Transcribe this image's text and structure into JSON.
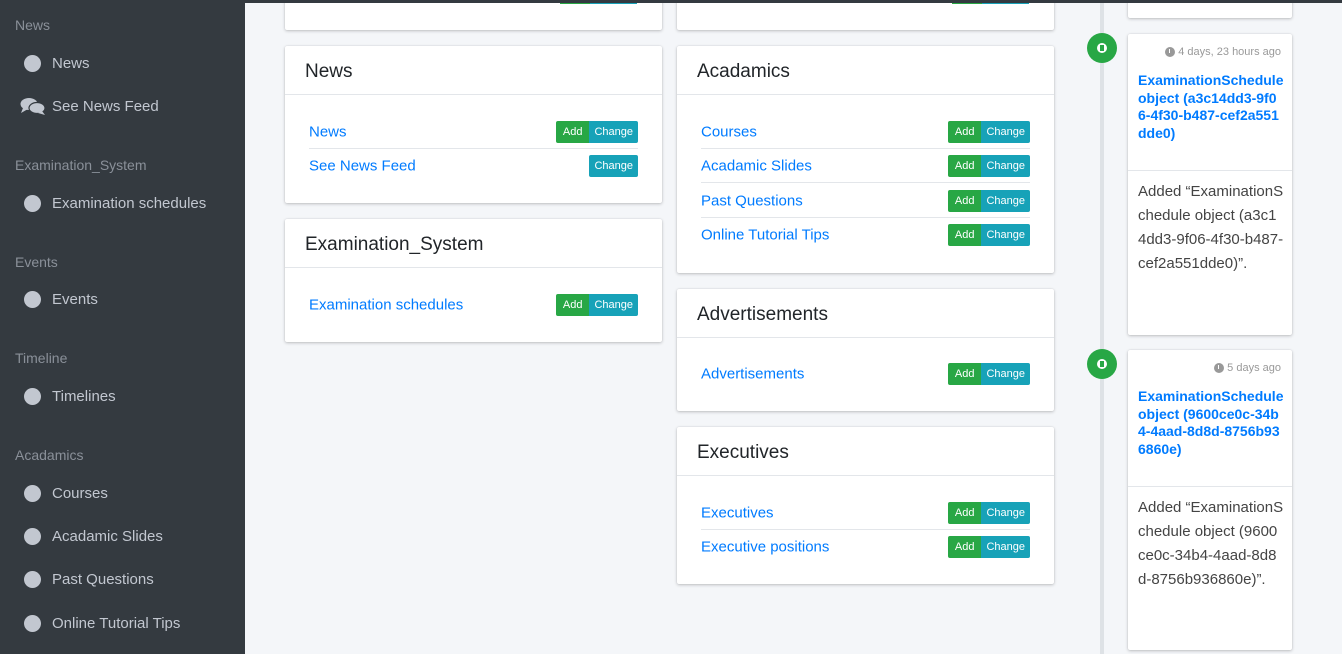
{
  "sidebar": {
    "sections": [
      {
        "header": "News",
        "items": [
          {
            "label": "News",
            "icon": "circle-icon"
          },
          {
            "label": "See News Feed",
            "icon": "comments-icon"
          }
        ]
      },
      {
        "header": "Examination_System",
        "items": [
          {
            "label": "Examination schedules",
            "icon": "circle-icon"
          }
        ]
      },
      {
        "header": "Events",
        "items": [
          {
            "label": "Events",
            "icon": "circle-icon"
          }
        ]
      },
      {
        "header": "Timeline",
        "items": [
          {
            "label": "Timelines",
            "icon": "circle-icon"
          }
        ]
      },
      {
        "header": "Acadamics",
        "items": [
          {
            "label": "Courses",
            "icon": "circle-icon"
          },
          {
            "label": "Acadamic Slides",
            "icon": "circle-icon"
          },
          {
            "label": "Past Questions",
            "icon": "circle-icon"
          },
          {
            "label": "Online Tutorial Tips",
            "icon": "circle-icon"
          }
        ]
      }
    ]
  },
  "buttons": {
    "add": "Add",
    "change": "Change"
  },
  "apps": {
    "news": {
      "title": "News",
      "models": [
        {
          "label": "News"
        },
        {
          "label": "See News Feed"
        }
      ]
    },
    "examination": {
      "title": "Examination_System",
      "models": [
        {
          "label": "Examination schedules"
        }
      ]
    },
    "acadamics": {
      "title": "Acadamics",
      "models": [
        {
          "label": "Courses"
        },
        {
          "label": "Acadamic Slides"
        },
        {
          "label": "Past Questions"
        },
        {
          "label": "Online Tutorial Tips"
        }
      ]
    },
    "advertisements": {
      "title": "Advertisements",
      "models": [
        {
          "label": "Advertisements"
        }
      ]
    },
    "executives": {
      "title": "Executives",
      "models": [
        {
          "label": "Executives"
        },
        {
          "label": "Executive positions"
        }
      ]
    }
  },
  "timeline": [
    {
      "time": "4 days, 23 hours ago",
      "title": "ExaminationSchedule object (a3c14dd3-9f06-4f30-b487-cef2a551dde0)",
      "body": "Added “ExaminationSchedule object (a3c14dd3-9f06-4f30-b487-cef2a551dde0)”."
    },
    {
      "time": "5 days ago",
      "title": "ExaminationSchedule object (9600ce0c-34b4-4aad-8d8d-8756b936860e)",
      "body": "Added “ExaminationSchedule object (9600ce0c-34b4-4aad-8d8d-8756b936860e)”."
    }
  ],
  "colors": {
    "sidebar_bg": "#343a40",
    "add_button": "#28a745",
    "change_button": "#17a2b8",
    "link": "#007bff"
  }
}
